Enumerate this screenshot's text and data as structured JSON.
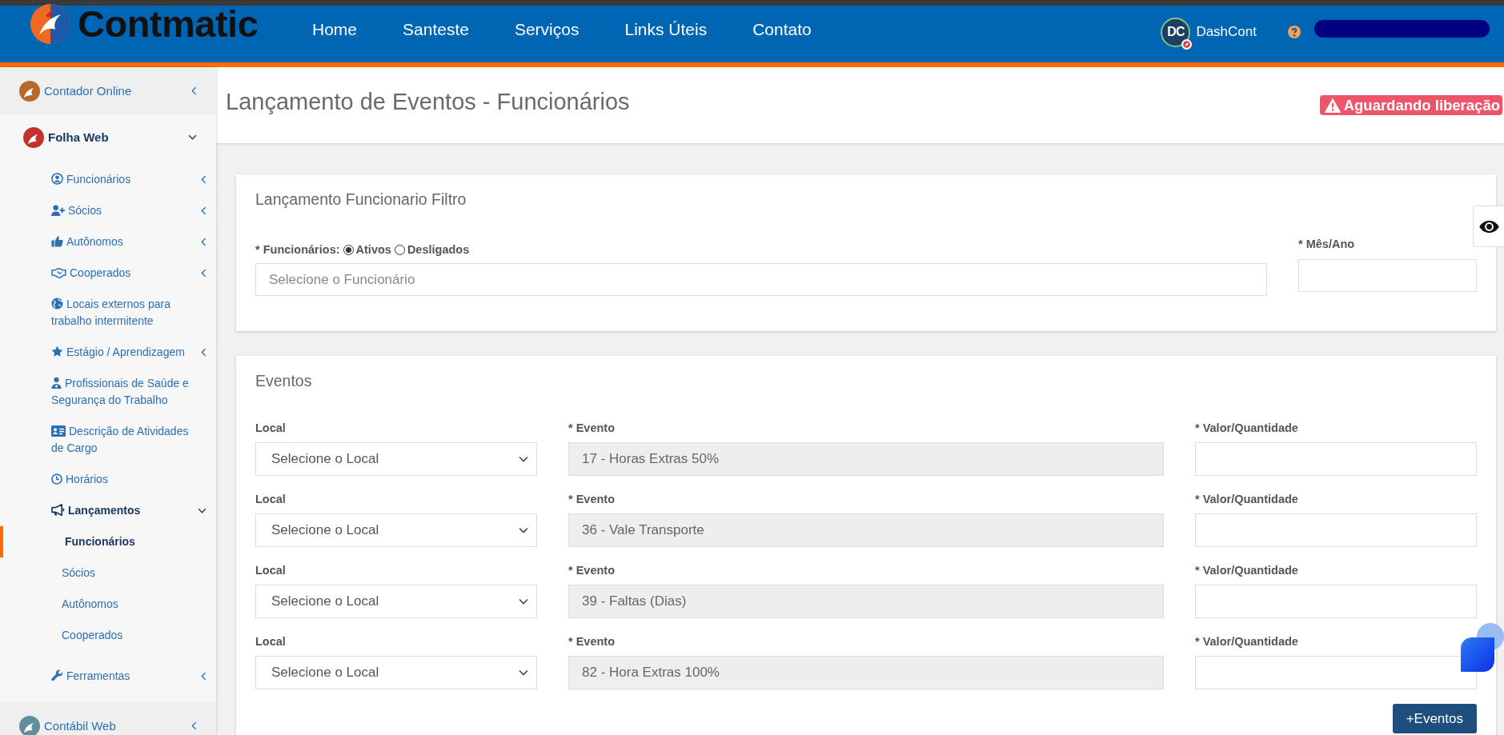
{
  "header": {
    "logo_text": "Contmatic",
    "nav": [
      "Home",
      "Santeste",
      "Serviços",
      "Links Úteis",
      "Contato"
    ],
    "app_link": {
      "initials": "DC",
      "label": "DashCont"
    }
  },
  "sidebar": {
    "items": [
      {
        "label": "Contador Online",
        "expanded": false,
        "selected": false
      },
      {
        "label": "Folha Web",
        "expanded": true,
        "selected": false,
        "children": [
          {
            "label": "Funcionários",
            "expanded": false,
            "selected": false
          },
          {
            "label": "Sócios",
            "expanded": false,
            "selected": false
          },
          {
            "label": "Autônomos",
            "expanded": false,
            "selected": false
          },
          {
            "label": "Cooperados",
            "expanded": false,
            "selected": false
          },
          {
            "label": "Locais externos para trabalho intermitente",
            "selected": false
          },
          {
            "label": "Estágio / Aprendizagem",
            "expanded": false,
            "selected": false
          },
          {
            "label": "Profissionais de Saúde e Segurança do Trabalho",
            "selected": false
          },
          {
            "label": "Descrição de Atividades de Cargo",
            "selected": false
          },
          {
            "label": "Horários",
            "selected": false
          },
          {
            "label": "Lançamentos",
            "expanded": true,
            "selected": false,
            "children": [
              {
                "label": "Funcionários",
                "selected": true
              },
              {
                "label": "Sócios",
                "selected": false
              },
              {
                "label": "Autônomos",
                "selected": false
              },
              {
                "label": "Cooperados",
                "selected": false
              }
            ]
          },
          {
            "label": "Ferramentas",
            "expanded": false,
            "selected": false
          }
        ]
      },
      {
        "label": "Contábil Web",
        "expanded": false,
        "selected": false
      }
    ]
  },
  "page": {
    "title": "Lançamento de Eventos - Funcionários",
    "status_badge": "Aguardando liberação"
  },
  "filter": {
    "title": "Lançamento Funcionario Filtro",
    "employee_label": "* Funcionários:",
    "status_options": [
      {
        "label": "Ativos",
        "selected": true
      },
      {
        "label": "Desligados",
        "selected": false
      }
    ],
    "employee_placeholder": "Selecione o Funcionário",
    "month_label": "* Mês/Ano"
  },
  "events": {
    "title": "Eventos",
    "rows": [
      {
        "local_label": "Local",
        "local_value": "Selecione o Local",
        "event_label": "* Evento",
        "event_value": "17 - Horas Extras 50%",
        "event_disabled": true,
        "amount_label": "* Valor/Quantidade"
      },
      {
        "local_label": "Local",
        "local_value": "Selecione o Local",
        "event_label": "* Evento",
        "event_value": "36 - Vale Transporte",
        "event_disabled": true,
        "amount_label": "* Valor/Quantidade"
      },
      {
        "local_label": "Local",
        "local_value": "Selecione o Local",
        "event_label": "* Evento",
        "event_value": "39 - Faltas (Dias)",
        "event_disabled": true,
        "amount_label": "* Valor/Quantidade"
      },
      {
        "local_label": "Local",
        "local_value": "Selecione o Local",
        "event_label": "* Evento",
        "event_value": "82 - Hora Extras 100%",
        "event_disabled": true,
        "amount_label": "* Valor/Quantidade"
      }
    ],
    "add_button": "+Eventos"
  }
}
